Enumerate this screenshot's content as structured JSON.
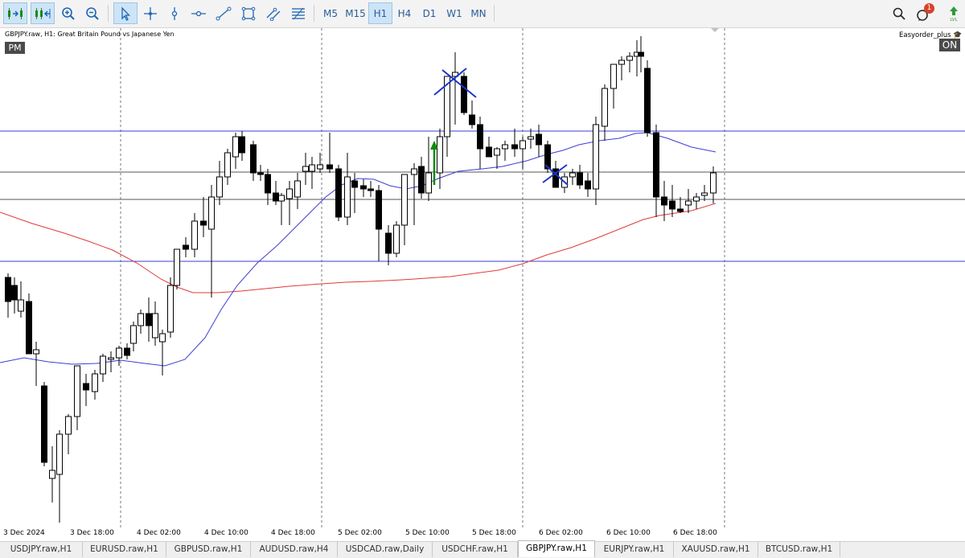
{
  "toolbar": {
    "tools": [
      {
        "name": "chart-shift-icon"
      },
      {
        "name": "autoscroll-icon"
      },
      {
        "name": "zoom-in-icon"
      },
      {
        "name": "zoom-out-icon"
      },
      {
        "name": "cursor-icon"
      },
      {
        "name": "crosshair-icon"
      },
      {
        "name": "vertical-line-icon"
      },
      {
        "name": "horizontal-line-icon"
      },
      {
        "name": "trend-line-icon"
      },
      {
        "name": "rectangle-icon"
      },
      {
        "name": "channel-icon"
      },
      {
        "name": "fibonacci-icon"
      }
    ],
    "timeframes": [
      "M5",
      "M15",
      "H1",
      "H4",
      "D1",
      "W1",
      "MN"
    ],
    "active_timeframe": "H1",
    "notification_count": "1"
  },
  "chart": {
    "title": "GBPJPY.raw, H1:  Great Britain Pound vs Japanese Yen",
    "session_badge": "PM",
    "ea_name": "Easyorder_plus",
    "ea_status": "ON",
    "time_labels": [
      "3 Dec 2024",
      "3 Dec 18:00",
      "4 Dec 02:00",
      "4 Dec 10:00",
      "4 Dec 18:00",
      "5 Dec 02:00",
      "5 Dec 10:00",
      "5 Dec 18:00",
      "6 Dec 02:00",
      "6 Dec 10:00",
      "6 Dec 18:00"
    ],
    "colors": {
      "bull_body": "#ffffff",
      "bear_body": "#000000",
      "ma_fast": "#3d3dd6",
      "ma_slow": "#e03a3a",
      "hline_blue": "#3d3dd6",
      "hline_gray": "#555555",
      "marker": "#1a36c8",
      "arrow": "#0f8a0f"
    }
  },
  "tabs": [
    {
      "label": "USDJPY.raw,H1"
    },
    {
      "label": "EURUSD.raw,H1"
    },
    {
      "label": "GBPUSD.raw,H1"
    },
    {
      "label": "AUDUSD.raw,H4"
    },
    {
      "label": "USDCAD.raw,Daily"
    },
    {
      "label": "USDCHF.raw,H1"
    },
    {
      "label": "GBPJPY.raw,H1"
    },
    {
      "label": "EURJPY.raw,H1"
    },
    {
      "label": "XAUUSD.raw,H1"
    },
    {
      "label": "BTCUSD.raw,H1"
    }
  ],
  "active_tab": "GBPJPY.raw,H1"
}
